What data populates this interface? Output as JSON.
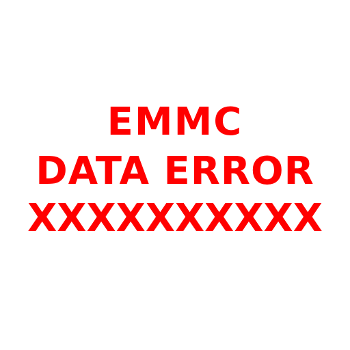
{
  "message": {
    "line1": "EMMC",
    "line2": "DATA ERROR",
    "line3": "XXXXXXXXXX",
    "color": "#ff0000"
  },
  "background_color": "#ffffff"
}
